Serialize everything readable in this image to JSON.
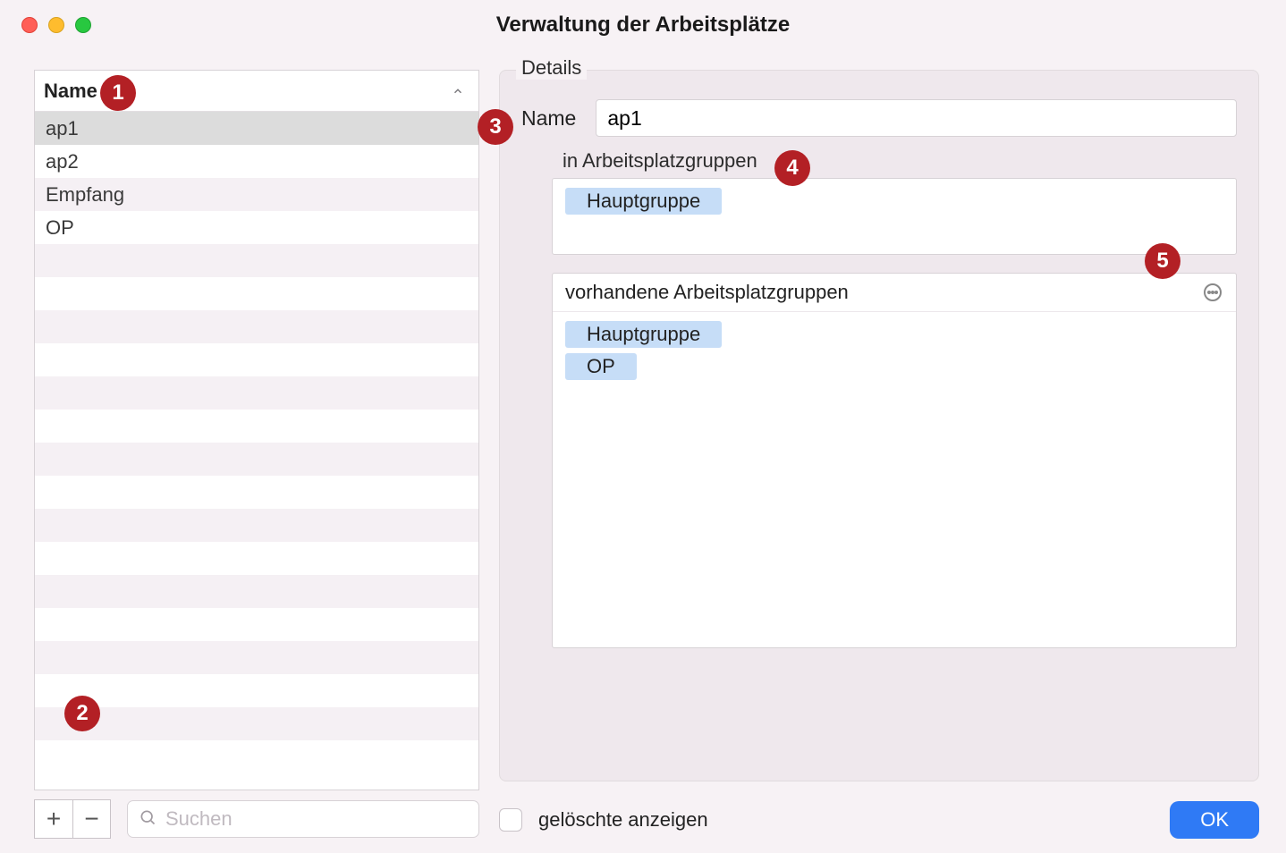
{
  "window": {
    "title": "Verwaltung der Arbeitsplätze"
  },
  "left": {
    "column_header": "Name",
    "items": [
      "ap1",
      "ap2",
      "Empfang",
      "OP"
    ],
    "selected_index": 0,
    "search_placeholder": "Suchen",
    "add_label": "+",
    "remove_label": "−"
  },
  "details": {
    "legend": "Details",
    "name_label": "Name",
    "name_value": "ap1",
    "in_groups_label": "in Arbeitsplatzgruppen",
    "in_groups": [
      "Hauptgruppe"
    ],
    "available_groups_label": "vorhandene Arbeitsplatzgruppen",
    "available_groups": [
      "Hauptgruppe",
      "OP"
    ]
  },
  "footer": {
    "show_deleted_label": "gelöschte anzeigen",
    "ok_label": "OK"
  },
  "markers": {
    "1": "1",
    "2": "2",
    "3": "3",
    "4": "4",
    "5": "5"
  }
}
